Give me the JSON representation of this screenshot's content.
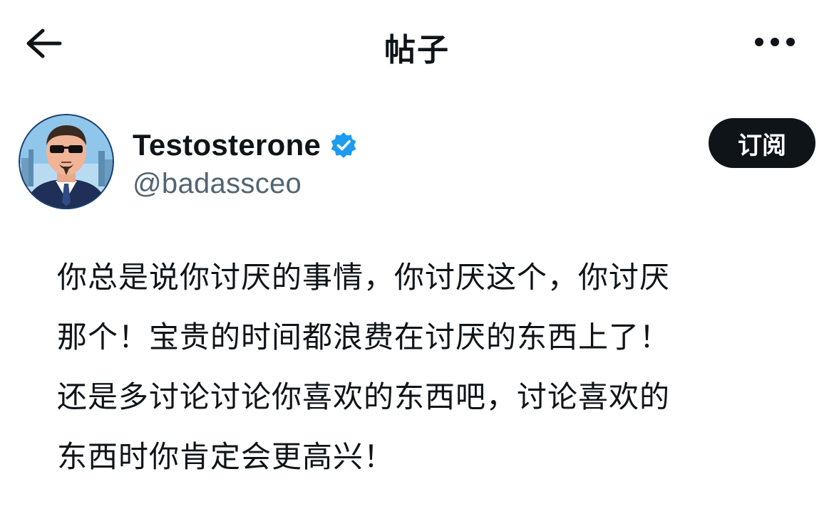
{
  "header": {
    "title": "帖子",
    "back_icon": "arrow-left-icon",
    "more_icon": "more-horizontal-icon"
  },
  "author": {
    "name": "Testosterone",
    "handle": "@badassceo",
    "verified": true,
    "verified_color": "#1d9bf0",
    "subscribe_label": "订阅"
  },
  "post": {
    "lines": [
      "你总是说你讨厌的事情，你讨厌这个，你讨厌",
      "那个！宝贵的时间都浪费在讨厌的东西上了！",
      "还是多讨论讨论你喜欢的东西吧，讨论喜欢的",
      "东西时你肯定会更高兴！"
    ]
  }
}
